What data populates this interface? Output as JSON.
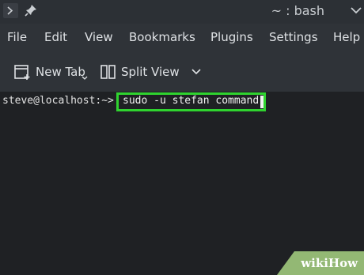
{
  "window": {
    "title": "~ : bash",
    "icons": [
      "terminal-icon",
      "pin-icon",
      "chevron-down-icon"
    ]
  },
  "menu": {
    "items": [
      "File",
      "Edit",
      "View",
      "Bookmarks",
      "Plugins",
      "Settings",
      "Help"
    ]
  },
  "toolbar": {
    "new_tab_label": "New Tab",
    "split_view_label": "Split View"
  },
  "terminal": {
    "prompt": "steve@localhost:~>",
    "command": "sudo -u stefan command"
  },
  "colors": {
    "highlight": "#2fd32f",
    "watermark_bg": "#93b874"
  },
  "watermark": {
    "wiki": "wiki",
    "how": "How"
  }
}
